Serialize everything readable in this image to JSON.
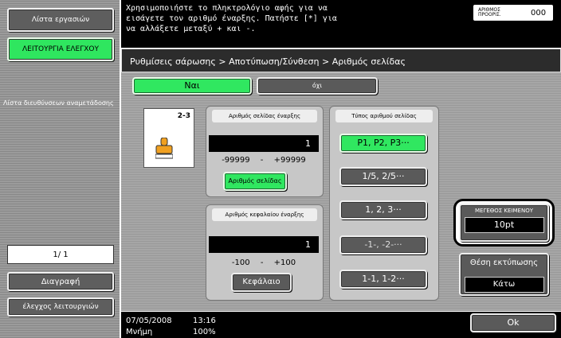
{
  "left_panel": {
    "task_list_button": "Λίστα εργασιών",
    "control_functions_button": "ΛΕΙΤΟΥΡΓΙΑ ΕΛΕΓΧΟΥ",
    "redirect_list_label": "Λίστα διευθύνσεων αναμετάδοσης",
    "page_indicator": "1/  1",
    "delete_button": "Διαγραφή",
    "check_functions_button": "έλεγχος λειτουργιών"
  },
  "header": {
    "message_line1": "Χρησιμοποιήστε το πληκτρολόγιο αφής για να",
    "message_line2": "εισάγετε τον αριθμό έναρξης. Πατήστε [*] για",
    "message_line3": "να αλλάξετε μεταξύ + και -.",
    "copies_label": "ΑΡΙΘΜΟΣ ΑΝΤΙΓΡΑΦΩΝ",
    "copies_label_display": "ΑΡΙΘΜΟΣ ΠΡΟΟΡΙΣ.",
    "copies_value": "000"
  },
  "breadcrumb": "Ρυθμίσεις σάρωσης > Αποτύπωση/Σύνθεση > Αριθμός σελίδας",
  "toggle": {
    "yes_label": "Ναι",
    "no_label": "όχι"
  },
  "preview": {
    "page_label": "2-3"
  },
  "start_page": {
    "title": "Αριθμός σελίδας έναρξης",
    "value": "1",
    "range_min": "-99999",
    "range_sep": "-",
    "range_max": "+99999",
    "button": "Αριθμός σελίδας"
  },
  "start_chapter": {
    "title": "Αριθμός κεφαλαίου έναρξης",
    "value": "1",
    "range_min": "-100",
    "range_sep": "-",
    "range_max": "+100",
    "button": "Κεφάλαιο"
  },
  "number_type": {
    "title": "Τύπος αριθμού σελίδας",
    "options": [
      "P1, P2, P3···",
      "1/5, 2/5···",
      "1, 2, 3···",
      "-1-, -2-···",
      "1-1, 1-2···"
    ]
  },
  "right_panel": {
    "text_size_label": "ΜΕΓΕΘΟΣ ΚΕΙΜΕΝΟΥ",
    "text_size_value": "10pt",
    "print_position_label": "Θέση εκτύπωσης",
    "print_position_value": "Κάτω"
  },
  "status": {
    "date": "07/05/2008",
    "time": "13:16",
    "memory_label": "Μνήμη",
    "memory_value": "100%",
    "ok_button": "Ok"
  },
  "colors": {
    "accent_green": "#30e760",
    "dark_button": "#5a5a5a"
  }
}
